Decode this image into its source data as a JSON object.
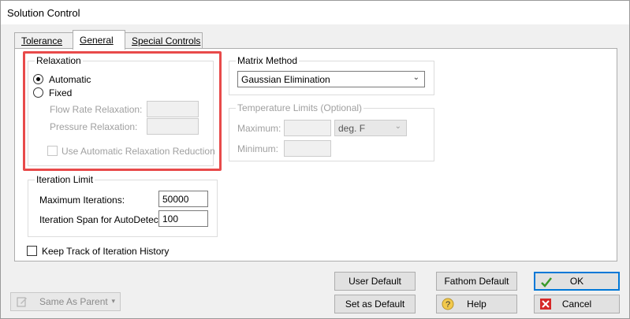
{
  "window": {
    "title": "Solution Control"
  },
  "tabs": [
    {
      "label": "Tolerance"
    },
    {
      "label": "General"
    },
    {
      "label": "Special Controls"
    }
  ],
  "relaxation": {
    "group_label": "Relaxation",
    "automatic_label": "Automatic",
    "fixed_label": "Fixed",
    "selected": "Automatic",
    "flow_rate_label": "Flow Rate Relaxation:",
    "flow_rate_value": "",
    "pressure_label": "Pressure Relaxation:",
    "pressure_value": "",
    "auto_reduction_label": "Use Automatic Relaxation Reduction",
    "auto_reduction_checked": false
  },
  "matrix_method": {
    "group_label": "Matrix Method",
    "selected": "Gaussian Elimination"
  },
  "temperature_limits": {
    "group_label": "Temperature Limits (Optional)",
    "maximum_label": "Maximum:",
    "maximum_value": "",
    "minimum_label": "Minimum:",
    "minimum_value": "",
    "unit": "deg. F"
  },
  "iteration_limit": {
    "group_label": "Iteration Limit",
    "max_iterations_label": "Maximum Iterations:",
    "max_iterations_value": "50000",
    "span_label": "Iteration Span for AutoDetect:",
    "span_value": "100"
  },
  "keep_track": {
    "label": "Keep Track of Iteration History",
    "checked": false
  },
  "footer": {
    "same_as_parent": "Same As Parent",
    "user_default": "User Default",
    "fathom_default": "Fathom Default",
    "ok": "OK",
    "set_as_default": "Set as Default",
    "help": "Help",
    "cancel": "Cancel"
  },
  "colors": {
    "highlight": "#e84a4a",
    "focus_border": "#0078d7",
    "ok_check": "#3a9a2a",
    "cancel_icon": "#d62828"
  }
}
